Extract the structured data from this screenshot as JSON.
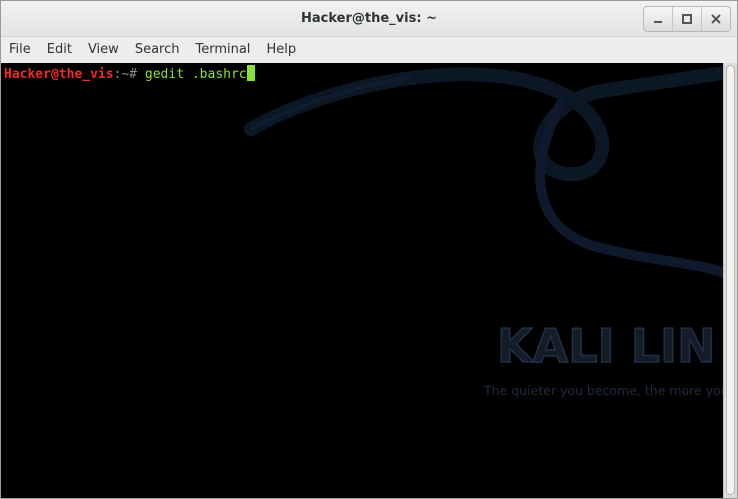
{
  "window": {
    "title": "Hacker@the_vis: ~",
    "controls": {
      "minimize_icon": "minimize-icon",
      "maximize_icon": "maximize-icon",
      "close_icon": "close-icon"
    }
  },
  "menu": {
    "items": [
      "File",
      "Edit",
      "View",
      "Search",
      "Terminal",
      "Help"
    ]
  },
  "terminal": {
    "prompt_user": "Hacker@the_vis",
    "prompt_sep": ":~# ",
    "command": "gedit .bashrc",
    "colors": {
      "user": "#ef2929",
      "command": "#8ae234",
      "background": "#000000"
    }
  },
  "watermark": {
    "brand": "KALI LIN",
    "tagline": "The quieter you become, the more you"
  }
}
